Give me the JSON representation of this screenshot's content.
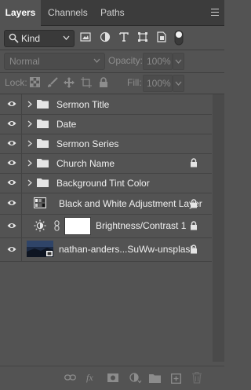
{
  "tabs": [
    "Layers",
    "Channels",
    "Paths"
  ],
  "filter": {
    "kind_label": "Kind"
  },
  "blend": {
    "mode": "Normal",
    "opacity_label": "Opacity:",
    "opacity_value": "100%"
  },
  "lock": {
    "label": "Lock:",
    "fill_label": "Fill:",
    "fill_value": "100%"
  },
  "layers": [
    {
      "name": "Sermon Title"
    },
    {
      "name": "Date"
    },
    {
      "name": "Sermon Series"
    },
    {
      "name": "Church Name"
    },
    {
      "name": "Background Tint Color"
    },
    {
      "name": "Black and White Adjustment Layer"
    },
    {
      "name": "Brightness/Contrast 1"
    },
    {
      "name": "nathan-anders...SuWw-unsplash"
    }
  ]
}
